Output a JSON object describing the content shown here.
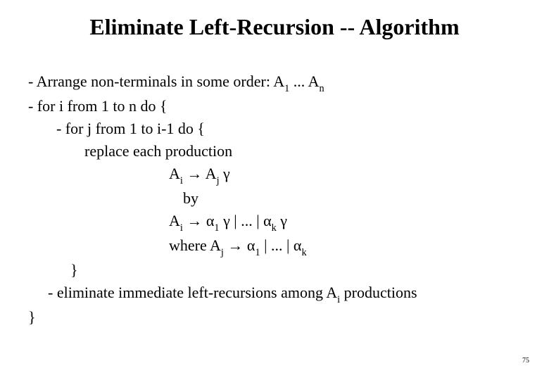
{
  "title": "Eliminate Left-Recursion -- Algorithm",
  "lines": {
    "l1_pre": "- Arrange non-terminals in some order:  A",
    "l1_sub1": "1",
    "l1_mid": " ... A",
    "l1_sub2": "n",
    "l2": "- for  i  from  1  to  n  do  {",
    "l3": "- for  j from  1 to i-1 do  {",
    "l4": "replace each production",
    "l5_a": "A",
    "l5_sub_i": "i",
    "l5_arrow": " → A",
    "l5_sub_j": "j",
    "l5_gamma": " γ",
    "l6": "by",
    "l7_a": "A",
    "l7_sub_i": "i",
    "l7_arrow": " → α",
    "l7_sub_1": "1",
    "l7_mid": " γ | ... | α",
    "l7_sub_k": "k",
    "l7_end": " γ",
    "l8_pre": "where A",
    "l8_sub_j": "j",
    "l8_arrow": " → α",
    "l8_sub_1": "1",
    "l8_mid": " | ... | α",
    "l8_sub_k": "k",
    "l9": "}",
    "l10_pre": "- eliminate immediate left-recursions among A",
    "l10_sub_i": "i",
    "l10_end": " productions",
    "l11": "}"
  },
  "page_number": "75"
}
